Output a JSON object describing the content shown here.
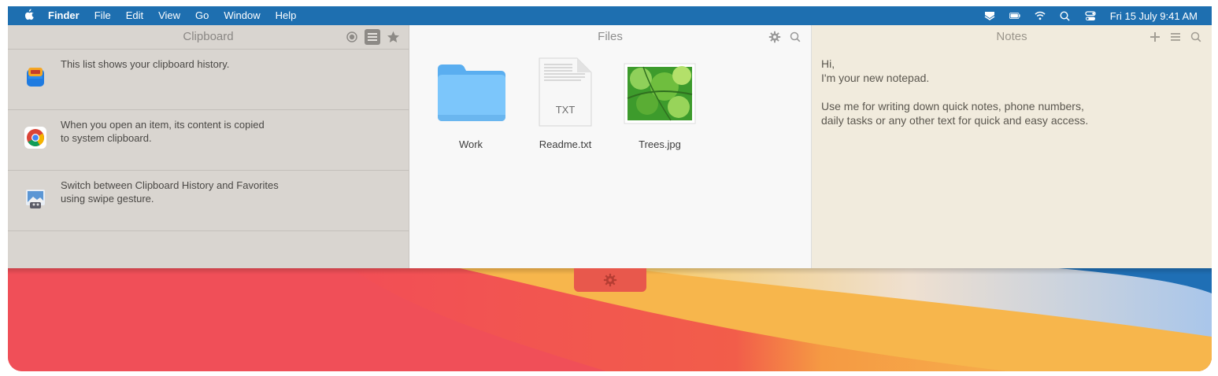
{
  "menubar": {
    "app_name": "Finder",
    "items": [
      "File",
      "Edit",
      "View",
      "Go",
      "Window",
      "Help"
    ],
    "clock": "Fri 15 July  9:41 AM",
    "status_icons": [
      "unclutter-icon",
      "battery-icon",
      "wifi-icon",
      "spotlight-search-icon",
      "control-center-icon"
    ]
  },
  "clipboard": {
    "title": "Clipboard",
    "header_icons": [
      "record-icon",
      "list-icon",
      "star-icon"
    ],
    "items": [
      {
        "icon": "clipboard-app-icon",
        "text": "This list shows your clipboard history."
      },
      {
        "icon": "chrome-icon",
        "text": "When you open an item, its content is copied\nto system clipboard."
      },
      {
        "icon": "preview-app-icon",
        "text": "Switch between Clipboard History and Favorites\nusing swipe gesture."
      }
    ]
  },
  "files": {
    "title": "Files",
    "header_icons": [
      "gear-icon",
      "search-icon"
    ],
    "items": [
      {
        "name": "Work",
        "type": "folder"
      },
      {
        "name": "Readme.txt",
        "type": "txt",
        "badge": "TXT"
      },
      {
        "name": "Trees.jpg",
        "type": "image"
      }
    ]
  },
  "notes": {
    "title": "Notes",
    "header_icons": [
      "plus-icon",
      "list-icon",
      "search-icon"
    ],
    "lines": [
      "Hi,",
      "I'm your new notepad.",
      "",
      "Use me for writing down quick notes, phone numbers,",
      "daily tasks or any other text for quick and easy access."
    ]
  },
  "colors": {
    "menubar": "#1e6fb0",
    "clipboard_bg": "#d9d5d0",
    "files_bg": "#f8f8f8",
    "notes_bg": "#f1ebdd",
    "gear_tab": "#e8584c"
  }
}
